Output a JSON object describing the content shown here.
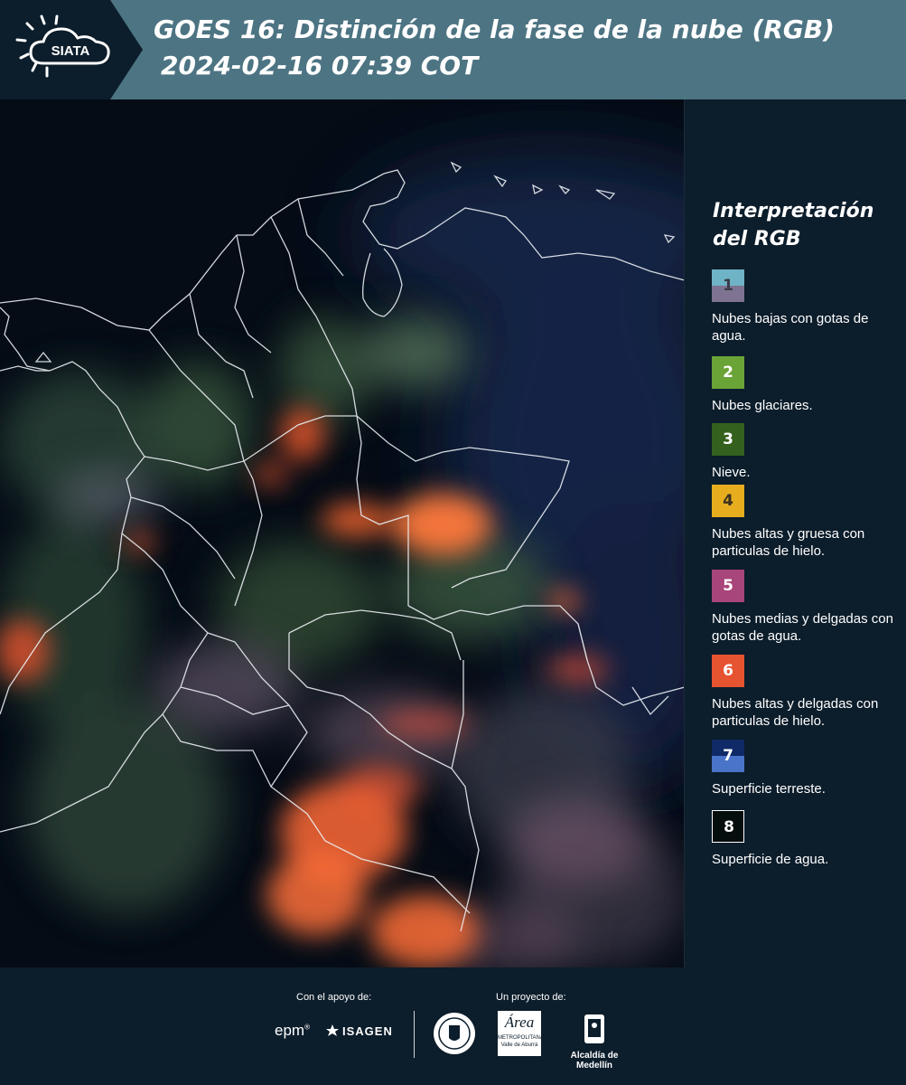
{
  "header": {
    "logo_text": "SIATA",
    "title_line1": "GOES 16: Distinción de la fase de la nube (RGB)",
    "title_line2": "2024-02-16 07:39 COT",
    "icon": "sun-cloud-logo"
  },
  "map": {
    "description_icon": "satellite-map"
  },
  "legend": {
    "title": "Interpretación del RGB",
    "items": [
      {
        "num": "1",
        "label": "Nubes bajas con gotas de agua.",
        "color_top": "#6fb3c6",
        "color_bottom": "#7e7391",
        "num_color": "#3a3a48"
      },
      {
        "num": "2",
        "label": "Nubes glaciares.",
        "color_top": "#6aa336",
        "color_bottom": "#6aa336",
        "num_color": "#ffffff"
      },
      {
        "num": "3",
        "label": "Nieve.",
        "color_top": "#34611e",
        "color_bottom": "#34611e",
        "num_color": "#ffffff"
      },
      {
        "num": "4",
        "label": "Nubes altas y gruesa con particulas de hielo.",
        "color_top": "#e6ad1e",
        "color_bottom": "#e6ad1e",
        "num_color": "#3a3020"
      },
      {
        "num": "5",
        "label": "Nubes medias y delgadas con gotas de agua.",
        "color_top": "#a8457a",
        "color_bottom": "#a8457a",
        "num_color": "#ffffff"
      },
      {
        "num": "6",
        "label": "Nubes altas y delgadas con particulas de hielo.",
        "color_top": "#e65330",
        "color_bottom": "#e65330",
        "num_color": "#ffffff"
      },
      {
        "num": "7",
        "label": "Superficie terreste.",
        "color_top": "#0f2a66",
        "color_bottom": "#4a74c8",
        "num_color": "#ffffff"
      },
      {
        "num": "8",
        "label": "Superficie de agua.",
        "color_top": "#050e0c",
        "color_bottom": "#050e0c",
        "num_color": "#ffffff"
      }
    ]
  },
  "footer": {
    "support_label": "Con el apoyo de:",
    "project_label": "Un proyecto de:",
    "epm_text": "epm",
    "isagen_text": "ISAGEN",
    "area_text": "Área",
    "area_sub1": "METROPOLITANA",
    "area_sub2": "Valle de Aburrá",
    "alcaldia_text": "Alcaldía de Medellín"
  }
}
